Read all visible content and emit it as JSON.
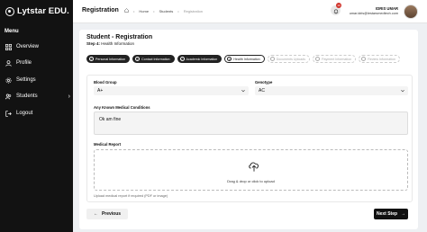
{
  "sidebar": {
    "logo_text": "Lytstar EDU.",
    "menu_label": "Menu",
    "items": [
      {
        "label": "Overview",
        "icon": "grid-icon"
      },
      {
        "label": "Profile",
        "icon": "user-icon"
      },
      {
        "label": "Settings",
        "icon": "gear-icon"
      },
      {
        "label": "Students",
        "icon": "users-icon"
      },
      {
        "label": "Logout",
        "icon": "logout-icon"
      }
    ]
  },
  "header": {
    "title": "Registration",
    "breadcrumb": [
      "Home",
      "Students",
      "Registration"
    ],
    "notification_count": "10",
    "user_name": "IDRIS UMAR",
    "user_email": "umar.idris@lestarsmedtech.com"
  },
  "card": {
    "title": "Student - Registration",
    "step_prefix": "Step 4:",
    "step_name": "Health Information",
    "steps": [
      {
        "label": "Personal Information",
        "state": "done"
      },
      {
        "label": "Contact Information",
        "state": "done"
      },
      {
        "label": "Academic Information",
        "state": "done"
      },
      {
        "label": "Health Information",
        "state": "active"
      },
      {
        "label": "Documents Uploads",
        "state": "todo"
      },
      {
        "label": "Payment Information",
        "state": "todo"
      },
      {
        "label": "Review Information",
        "state": "todo"
      }
    ]
  },
  "form": {
    "blood_group_label": "Blood Group",
    "blood_group_value": "A+",
    "genotype_label": "Genotype",
    "genotype_value": "AC",
    "conditions_label": "Any Known Medical Conditions",
    "conditions_value": "Ok am fine",
    "report_label": "Medical Report",
    "upload_text": "Drag & drop or click to upload",
    "upload_hint": "Upload medical report if required (PDF or image)"
  },
  "actions": {
    "prev_label": "Previous",
    "next_label": "Next Step"
  },
  "colors": {
    "sidebar_bg": "#121212",
    "primary": "#111111",
    "page_bg": "#eef0f3"
  }
}
